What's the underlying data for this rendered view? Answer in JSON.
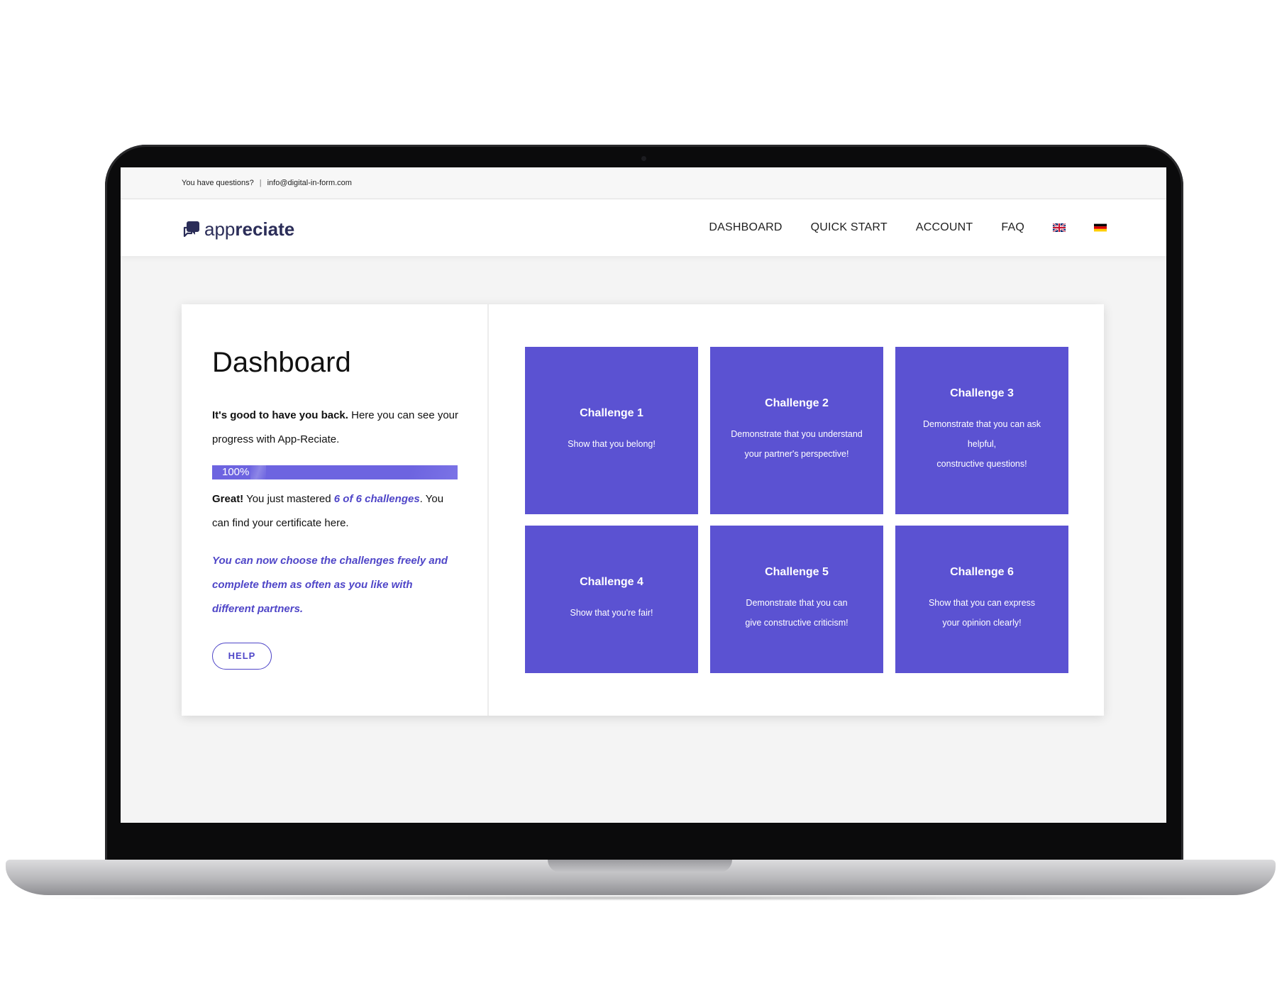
{
  "topbar": {
    "question": "You have questions?",
    "separator": "|",
    "email": "info@digital-in-form.com"
  },
  "logo": {
    "light": "app",
    "bold": "reciate"
  },
  "nav": {
    "items": [
      "DASHBOARD",
      "QUICK START",
      "ACCOUNT",
      "FAQ"
    ],
    "flags": [
      "uk-flag-icon",
      "germany-flag-icon"
    ]
  },
  "dashboard": {
    "title": "Dashboard",
    "intro_bold": "It's good to have you back.",
    "intro_rest": " Here you can see your progress with App-Reciate.",
    "progress": {
      "label": "100%",
      "value": 100
    },
    "result_bold": "Great!",
    "result_pre": " You just mastered ",
    "result_highlight": "6 of 6 challenges",
    "result_post": ". You can find your certificate here.",
    "note": "You can now choose the challenges freely and complete them as often as you like with different partners.",
    "help_label": "HELP"
  },
  "challenges": [
    {
      "title": "Challenge 1",
      "lines": [
        "Show that you belong!"
      ]
    },
    {
      "title": "Challenge 2",
      "lines": [
        "Demonstrate that you understand",
        "your partner's perspective!"
      ]
    },
    {
      "title": "Challenge 3",
      "lines": [
        "Demonstrate that you can ask",
        "helpful,",
        "constructive questions!"
      ]
    },
    {
      "title": "Challenge 4",
      "lines": [
        "Show that you're fair!"
      ]
    },
    {
      "title": "Challenge 5",
      "lines": [
        "Demonstrate that you can",
        "give constructive criticism!"
      ]
    },
    {
      "title": "Challenge 6",
      "lines": [
        "Show that you can express",
        "your opinion clearly!"
      ]
    }
  ],
  "colors": {
    "accent": "#5b52d2",
    "accent_text": "#4f46c8",
    "logo": "#2b2d58"
  }
}
